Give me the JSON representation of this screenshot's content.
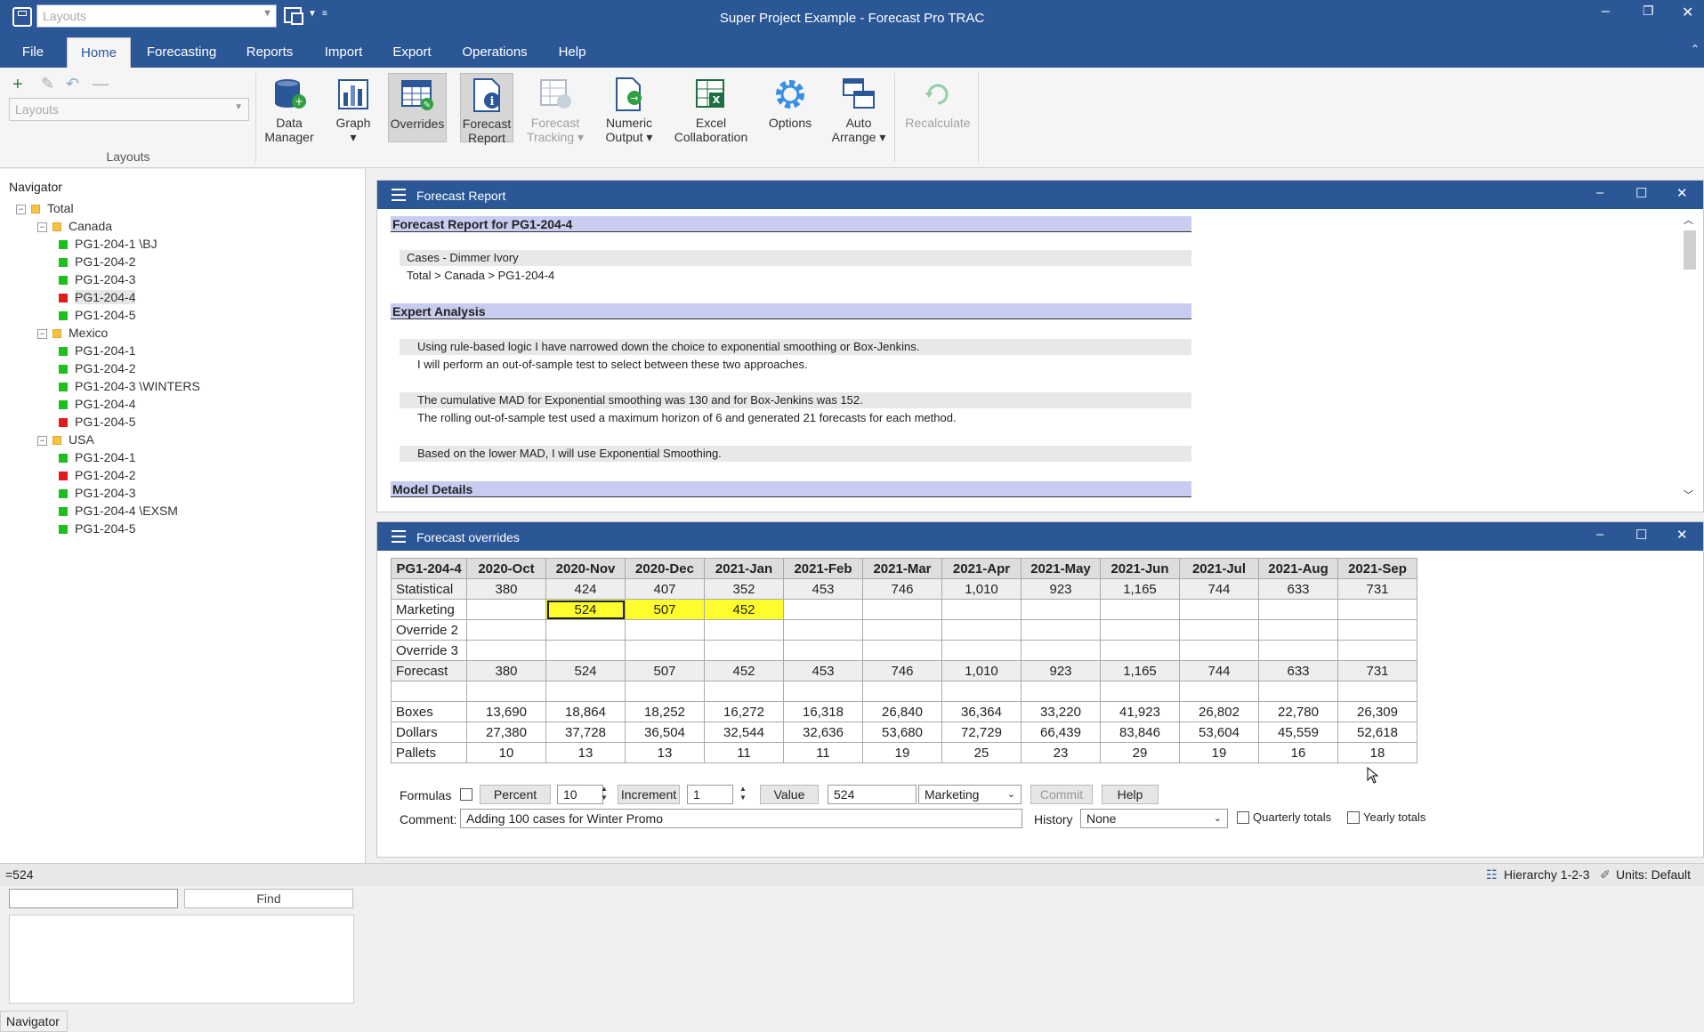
{
  "window": {
    "title": "Super Project Example - Forecast Pro TRAC",
    "quick_access_combo": "Layouts"
  },
  "ribbon_tabs": [
    "File",
    "Home",
    "Forecasting",
    "Reports",
    "Import",
    "Export",
    "Operations",
    "Help"
  ],
  "ribbon": {
    "layouts_combo": "Layouts",
    "group_label": "Layouts",
    "buttons": {
      "data_manager": [
        "Data",
        "Manager"
      ],
      "graph": [
        "Graph",
        "▾"
      ],
      "overrides": [
        "Overrides"
      ],
      "forecast_report": [
        "Forecast",
        "Report"
      ],
      "forecast_tracking": [
        "Forecast",
        "Tracking ▾"
      ],
      "numeric_output": [
        "Numeric",
        "Output ▾"
      ],
      "excel_collaboration": [
        "Excel",
        "Collaboration"
      ],
      "options": [
        "Options"
      ],
      "auto_arrange": [
        "Auto",
        "Arrange ▾"
      ],
      "recalculate": [
        "Recalculate"
      ]
    }
  },
  "navigator": {
    "title": "Navigator",
    "tab_label": "Navigator",
    "find_label": "Find",
    "tree": [
      {
        "label": "Total",
        "level": 0,
        "icon": "folder",
        "expander": "⊟"
      },
      {
        "label": "Canada",
        "level": 1,
        "icon": "folder",
        "expander": "⊟"
      },
      {
        "label": "PG1-204-1 \\BJ",
        "level": 2,
        "icon": "green"
      },
      {
        "label": "PG1-204-2",
        "level": 2,
        "icon": "green"
      },
      {
        "label": "PG1-204-3",
        "level": 2,
        "icon": "green"
      },
      {
        "label": "PG1-204-4",
        "level": 2,
        "icon": "red",
        "selected": true
      },
      {
        "label": "PG1-204-5",
        "level": 2,
        "icon": "green"
      },
      {
        "label": "Mexico",
        "level": 1,
        "icon": "folder",
        "expander": "⊟"
      },
      {
        "label": "PG1-204-1",
        "level": 2,
        "icon": "green"
      },
      {
        "label": "PG1-204-2",
        "level": 2,
        "icon": "green"
      },
      {
        "label": "PG1-204-3 \\WINTERS",
        "level": 2,
        "icon": "green"
      },
      {
        "label": "PG1-204-4",
        "level": 2,
        "icon": "green"
      },
      {
        "label": "PG1-204-5",
        "level": 2,
        "icon": "red"
      },
      {
        "label": "USA",
        "level": 1,
        "icon": "folder",
        "expander": "⊟"
      },
      {
        "label": "PG1-204-1",
        "level": 2,
        "icon": "green"
      },
      {
        "label": "PG1-204-2",
        "level": 2,
        "icon": "red"
      },
      {
        "label": "PG1-204-3",
        "level": 2,
        "icon": "green"
      },
      {
        "label": "PG1-204-4 \\EXSM",
        "level": 2,
        "icon": "green"
      },
      {
        "label": "PG1-204-5",
        "level": 2,
        "icon": "green"
      }
    ]
  },
  "forecast_report": {
    "panel_title": "Forecast Report",
    "heading": "Forecast Report for PG1-204-4",
    "item_desc": "Cases - Dimmer Ivory",
    "item_path": "Total > Canada > PG1-204-4",
    "expert_heading": "Expert Analysis",
    "expert_lines": [
      "Using rule-based logic I have narrowed down the choice to exponential smoothing or Box-Jenkins.",
      "I will perform an out-of-sample test to select between these two approaches.",
      "The cumulative MAD for Exponential smoothing was 130 and for Box-Jenkins was 152.",
      "The rolling out-of-sample test used a maximum horizon of 6 and generated 21 forecasts for each method.",
      "Based on the lower MAD, I will use Exponential Smoothing."
    ],
    "model_heading": "Model Details"
  },
  "overrides": {
    "panel_title": "Forecast overrides",
    "columns": [
      "PG1-204-4",
      "2020-Oct",
      "2020-Nov",
      "2020-Dec",
      "2021-Jan",
      "2021-Feb",
      "2021-Mar",
      "2021-Apr",
      "2021-May",
      "2021-Jun",
      "2021-Jul",
      "2021-Aug",
      "2021-Sep"
    ],
    "rows": [
      {
        "label": "Statistical",
        "cells": [
          "380",
          "424",
          "407",
          "352",
          "453",
          "746",
          "1,010",
          "923",
          "1,165",
          "744",
          "633",
          "731"
        ],
        "style": "gray"
      },
      {
        "label": "Marketing",
        "cells": [
          "",
          "524",
          "507",
          "452",
          "",
          "",
          "",
          "",
          "",
          "",
          "",
          ""
        ],
        "style": "white",
        "yellow": [
          1,
          2,
          3
        ],
        "focus": 1
      },
      {
        "label": "Override 2",
        "cells": [
          "",
          "",
          "",
          "",
          "",
          "",
          "",
          "",
          "",
          "",
          "",
          ""
        ],
        "style": "white"
      },
      {
        "label": "Override 3",
        "cells": [
          "",
          "",
          "",
          "",
          "",
          "",
          "",
          "",
          "",
          "",
          "",
          ""
        ],
        "style": "white"
      },
      {
        "label": "Forecast",
        "cells": [
          "380",
          "524",
          "507",
          "452",
          "453",
          "746",
          "1,010",
          "923",
          "1,165",
          "744",
          "633",
          "731"
        ],
        "style": "gray"
      },
      {
        "label": "",
        "cells": [
          "",
          "",
          "",
          "",
          "",
          "",
          "",
          "",
          "",
          "",
          "",
          ""
        ],
        "style": "white",
        "blank_label": true
      },
      {
        "label": "Boxes",
        "cells": [
          "13,690",
          "18,864",
          "18,252",
          "16,272",
          "16,318",
          "26,840",
          "36,364",
          "33,220",
          "41,923",
          "26,802",
          "22,780",
          "26,309"
        ],
        "style": "white"
      },
      {
        "label": "Dollars",
        "cells": [
          "27,380",
          "37,728",
          "36,504",
          "32,544",
          "32,636",
          "53,680",
          "72,729",
          "66,439",
          "83,846",
          "53,604",
          "45,559",
          "52,618"
        ],
        "style": "white"
      },
      {
        "label": "Pallets",
        "cells": [
          "10",
          "13",
          "13",
          "11",
          "11",
          "19",
          "25",
          "23",
          "29",
          "19",
          "16",
          "18"
        ],
        "style": "white"
      }
    ],
    "controls": {
      "formulas_label": "Formulas",
      "percent_label": "Percent",
      "percent_value": "10",
      "increment_label": "Increment",
      "increment_value": "1",
      "value_label": "Value",
      "value_input": "524",
      "row_select": "Marketing",
      "commit_label": "Commit",
      "help_label": "Help",
      "comment_label": "Comment:",
      "comment_value": "Adding 100 cases for Winter Promo",
      "history_label": "History",
      "history_value": "None",
      "quarterly_label": "Quarterly totals",
      "yearly_label": "Yearly totals"
    }
  },
  "status_bar": {
    "cell_value": "=524",
    "hierarchy": "Hierarchy 1-2-3",
    "units": "Units: Default"
  }
}
